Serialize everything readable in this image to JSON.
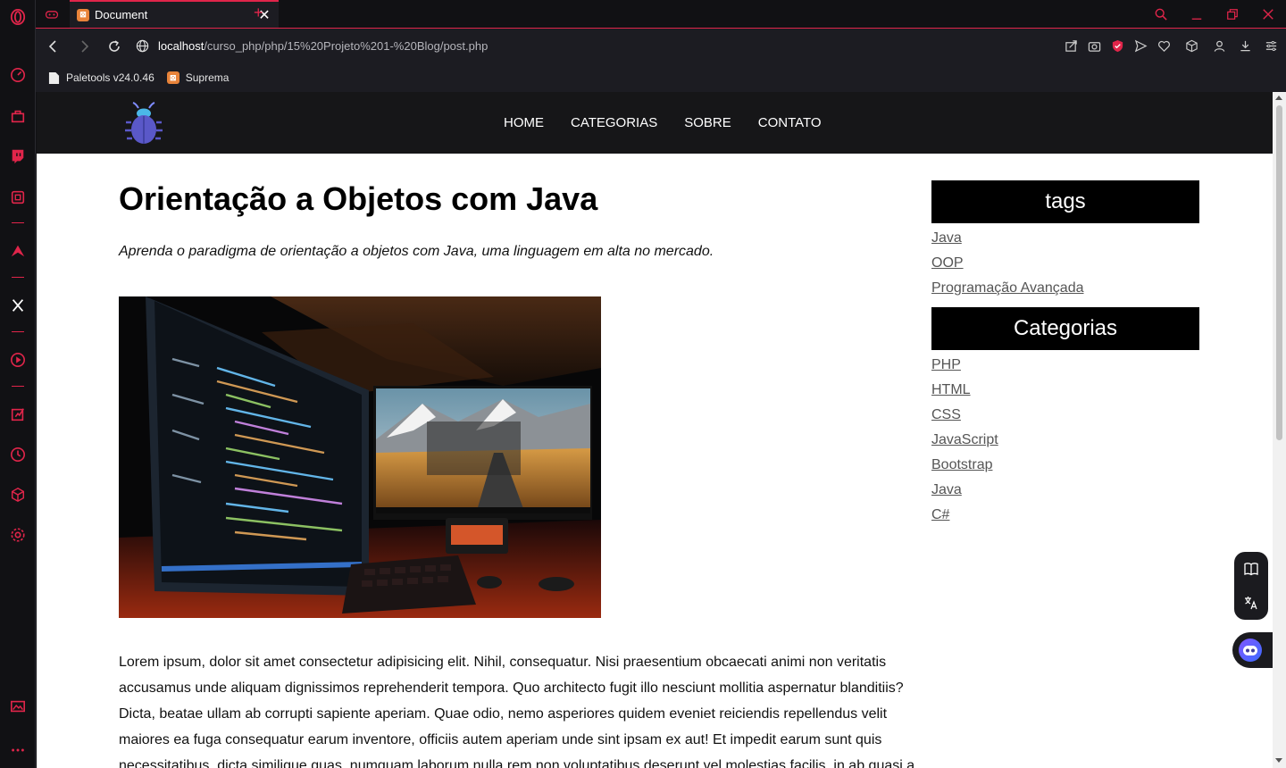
{
  "browser": {
    "tab_title": "Document",
    "url_host": "localhost",
    "url_path": "/curso_php/php/15%20Projeto%201-%20Blog/post.php",
    "accent_color": "#e0254a",
    "sidebar_icons": [
      "opera-logo-icon",
      "speed-dial-icon",
      "shopping-bag-icon",
      "twitch-icon",
      "crypto-wallet-icon",
      "aria-icon",
      "x-twitter-icon",
      "player-icon",
      "pinboard-icon",
      "history-icon",
      "extensions-icon",
      "settings-icon",
      "gallery-icon",
      "more-icon"
    ],
    "bookmarks": [
      {
        "label": "Paletools v24.0.46",
        "icon": "document-icon"
      },
      {
        "label": "Suprema",
        "icon": "xampp-icon"
      }
    ]
  },
  "site": {
    "nav": [
      "HOME",
      "CATEGORIAS",
      "SOBRE",
      "CONTATO"
    ]
  },
  "post": {
    "title": "Orientação a Objetos com Java",
    "subtitle": "Aprenda o paradigma de orientação a objetos com Java, uma linguagem em alta no mercado.",
    "body": "Lorem ipsum, dolor sit amet consectetur adipisicing elit. Nihil, consequatur. Nisi praesentium obcaecati animi non veritatis accusamus unde aliquam dignissimos reprehenderit tempora. Quo architecto fugit illo nesciunt mollitia aspernatur blanditiis? Dicta, beatae ullam ab corrupti sapiente aperiam. Quae odio, nemo asperiores quidem eveniet reiciendis repellendus velit maiores ea fuga consequatur earum inventore, officiis autem aperiam unde sint ipsam ex aut! Et impedit earum sunt quis necessitatibus, dicta similique quas, numquam laborum nulla rem non voluptatibus deserunt vel molestias facilis, in ab quasi a"
  },
  "aside": {
    "tags_heading": "tags",
    "tags": [
      "Java",
      "OOP",
      "Programação Avançada"
    ],
    "categories_heading": "Categorias",
    "categories": [
      "PHP",
      "HTML",
      "CSS",
      "JavaScript",
      "Bootstrap",
      "Java",
      "C#"
    ]
  }
}
